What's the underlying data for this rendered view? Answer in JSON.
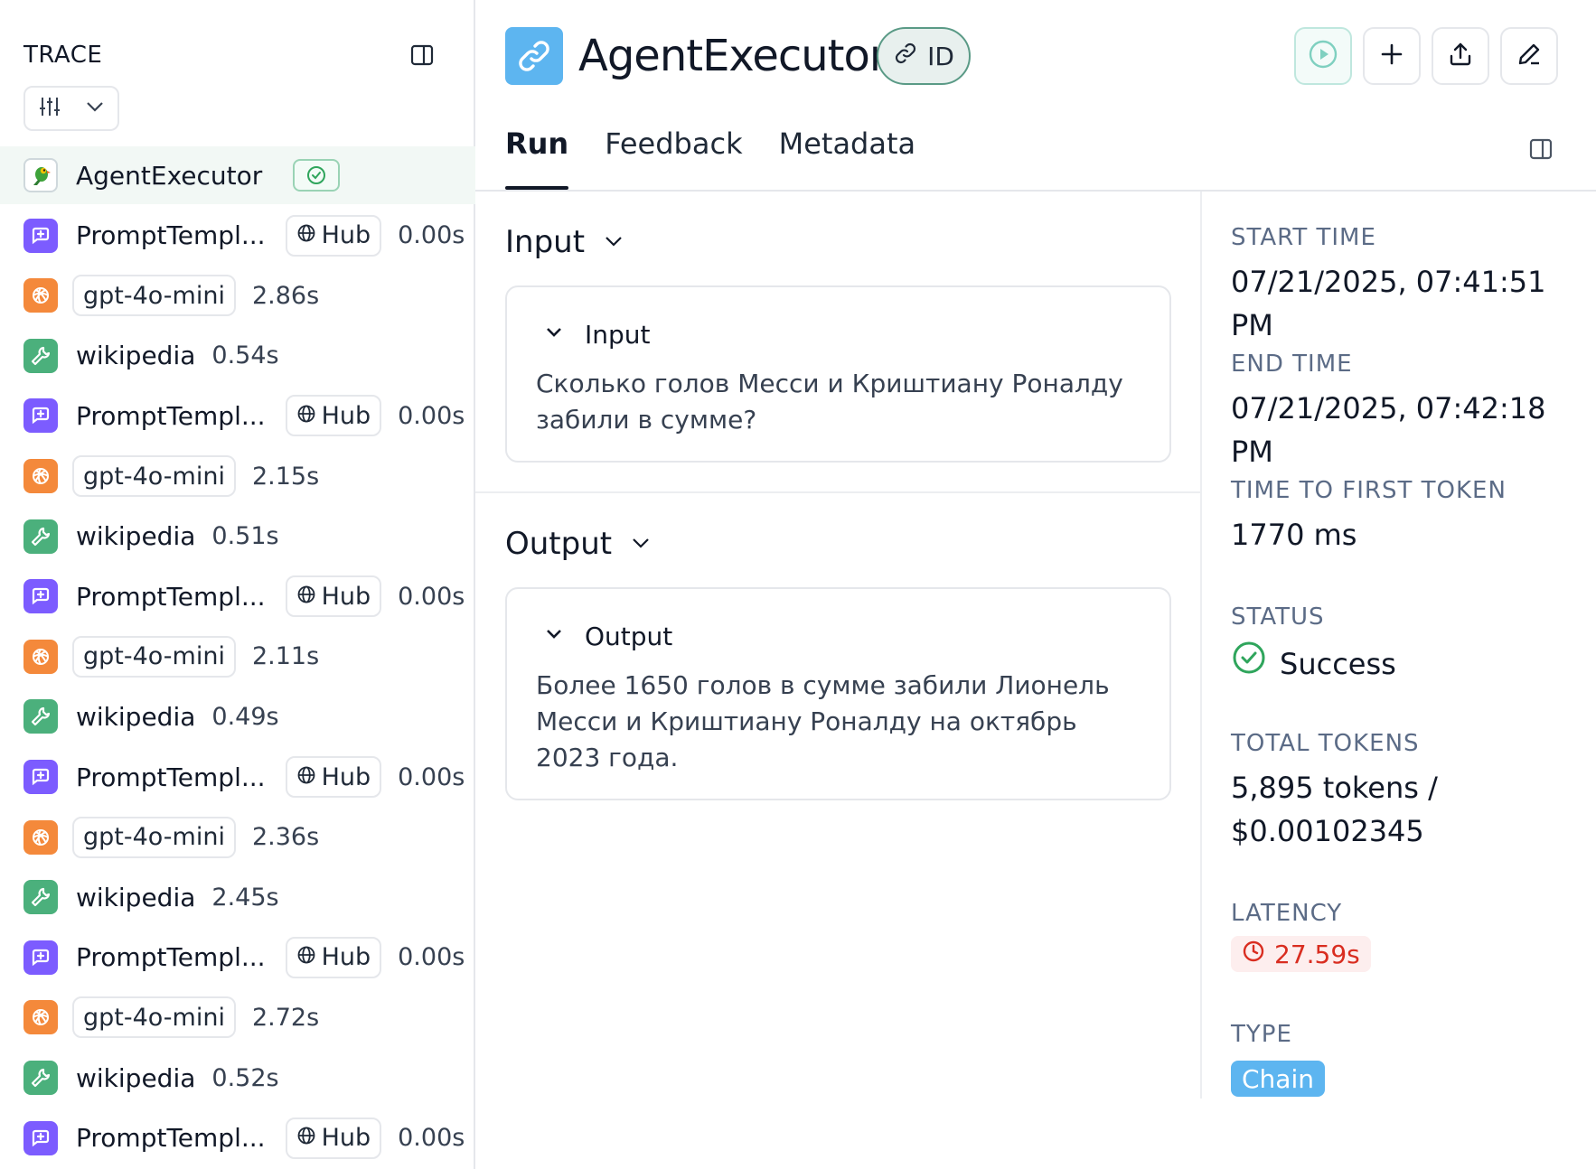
{
  "sidebar": {
    "title": "TRACE",
    "runs": [
      {
        "kind": "agent",
        "name": "AgentExecutor",
        "status": "success"
      },
      {
        "kind": "prompt",
        "name": "PromptTempl...",
        "hub": "Hub",
        "duration": "0.00s"
      },
      {
        "kind": "llm",
        "model": "gpt-4o-mini",
        "duration": "2.86s"
      },
      {
        "kind": "tool",
        "name": "wikipedia",
        "duration": "0.54s"
      },
      {
        "kind": "prompt",
        "name": "PromptTempl...",
        "hub": "Hub",
        "duration": "0.00s"
      },
      {
        "kind": "llm",
        "model": "gpt-4o-mini",
        "duration": "2.15s"
      },
      {
        "kind": "tool",
        "name": "wikipedia",
        "duration": "0.51s"
      },
      {
        "kind": "prompt",
        "name": "PromptTempl...",
        "hub": "Hub",
        "duration": "0.00s"
      },
      {
        "kind": "llm",
        "model": "gpt-4o-mini",
        "duration": "2.11s"
      },
      {
        "kind": "tool",
        "name": "wikipedia",
        "duration": "0.49s"
      },
      {
        "kind": "prompt",
        "name": "PromptTempl...",
        "hub": "Hub",
        "duration": "0.00s"
      },
      {
        "kind": "llm",
        "model": "gpt-4o-mini",
        "duration": "2.36s"
      },
      {
        "kind": "tool",
        "name": "wikipedia",
        "duration": "2.45s"
      },
      {
        "kind": "prompt",
        "name": "PromptTempl...",
        "hub": "Hub",
        "duration": "0.00s"
      },
      {
        "kind": "llm",
        "model": "gpt-4o-mini",
        "duration": "2.72s"
      },
      {
        "kind": "tool",
        "name": "wikipedia",
        "duration": "0.52s"
      },
      {
        "kind": "prompt",
        "name": "PromptTempl...",
        "hub": "Hub",
        "duration": "0.00s"
      }
    ]
  },
  "header": {
    "title": "AgentExecutor",
    "id_label": "ID"
  },
  "tabs": [
    "Run",
    "Feedback",
    "Metadata"
  ],
  "input": {
    "heading": "Input",
    "label": "Input",
    "text": "Сколько голов Месси и Криштиану Роналду забили в сумме?"
  },
  "output": {
    "heading": "Output",
    "label": "Output",
    "text": "Более 1650 голов в сумме забили Лионель Месси и Криштиану Роналду на октябрь 2023 года."
  },
  "details": {
    "start_time_label": "START TIME",
    "start_time": "07/21/2025, 07:41:51 PM",
    "end_time_label": "END TIME",
    "end_time": "07/21/2025, 07:42:18 PM",
    "ttft_label": "TIME TO FIRST TOKEN",
    "ttft": "1770 ms",
    "status_label": "STATUS",
    "status": "Success",
    "tokens_label": "TOTAL TOKENS",
    "tokens_line1": "5,895 tokens /",
    "tokens_line2": "$0.00102345",
    "latency_label": "LATENCY",
    "latency": "27.59s",
    "type_label": "TYPE",
    "type": "Chain"
  },
  "colors": {
    "prompt": "#7c5cff",
    "llm": "#f4893b",
    "tool": "#4bb07c",
    "chain": "#5db5f0",
    "latency_red": "#d92d20",
    "success_green": "#2fa55c"
  }
}
